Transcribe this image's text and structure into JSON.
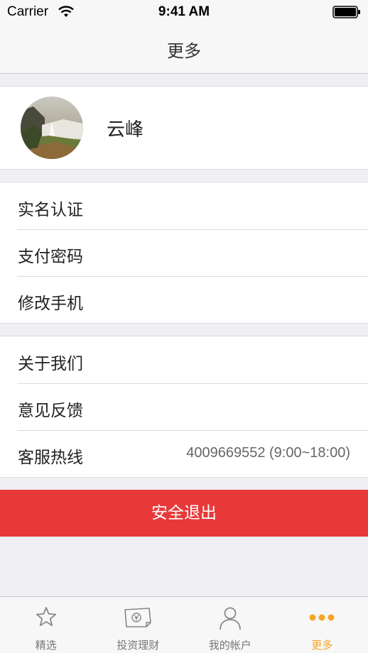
{
  "status_bar": {
    "carrier": "Carrier",
    "time": "9:41 AM"
  },
  "nav": {
    "title": "更多"
  },
  "profile": {
    "name": "云峰"
  },
  "account_rows": [
    {
      "label": "实名认证"
    },
    {
      "label": "支付密码"
    },
    {
      "label": "修改手机"
    }
  ],
  "about_rows": [
    {
      "label": "关于我们"
    },
    {
      "label": "意见反馈"
    },
    {
      "label": "客服热线",
      "value": "4009669552 (9:00~18:00)"
    }
  ],
  "logout": {
    "label": "安全退出"
  },
  "tabs": [
    {
      "label": "精选",
      "icon": "star-icon"
    },
    {
      "label": "投资理财",
      "icon": "money-icon"
    },
    {
      "label": "我的帐户",
      "icon": "user-icon"
    },
    {
      "label": "更多",
      "icon": "more-dots-icon",
      "active": true
    }
  ],
  "colors": {
    "accent": "#f5a623",
    "logout": "#e8393a",
    "background": "#efeff4"
  }
}
